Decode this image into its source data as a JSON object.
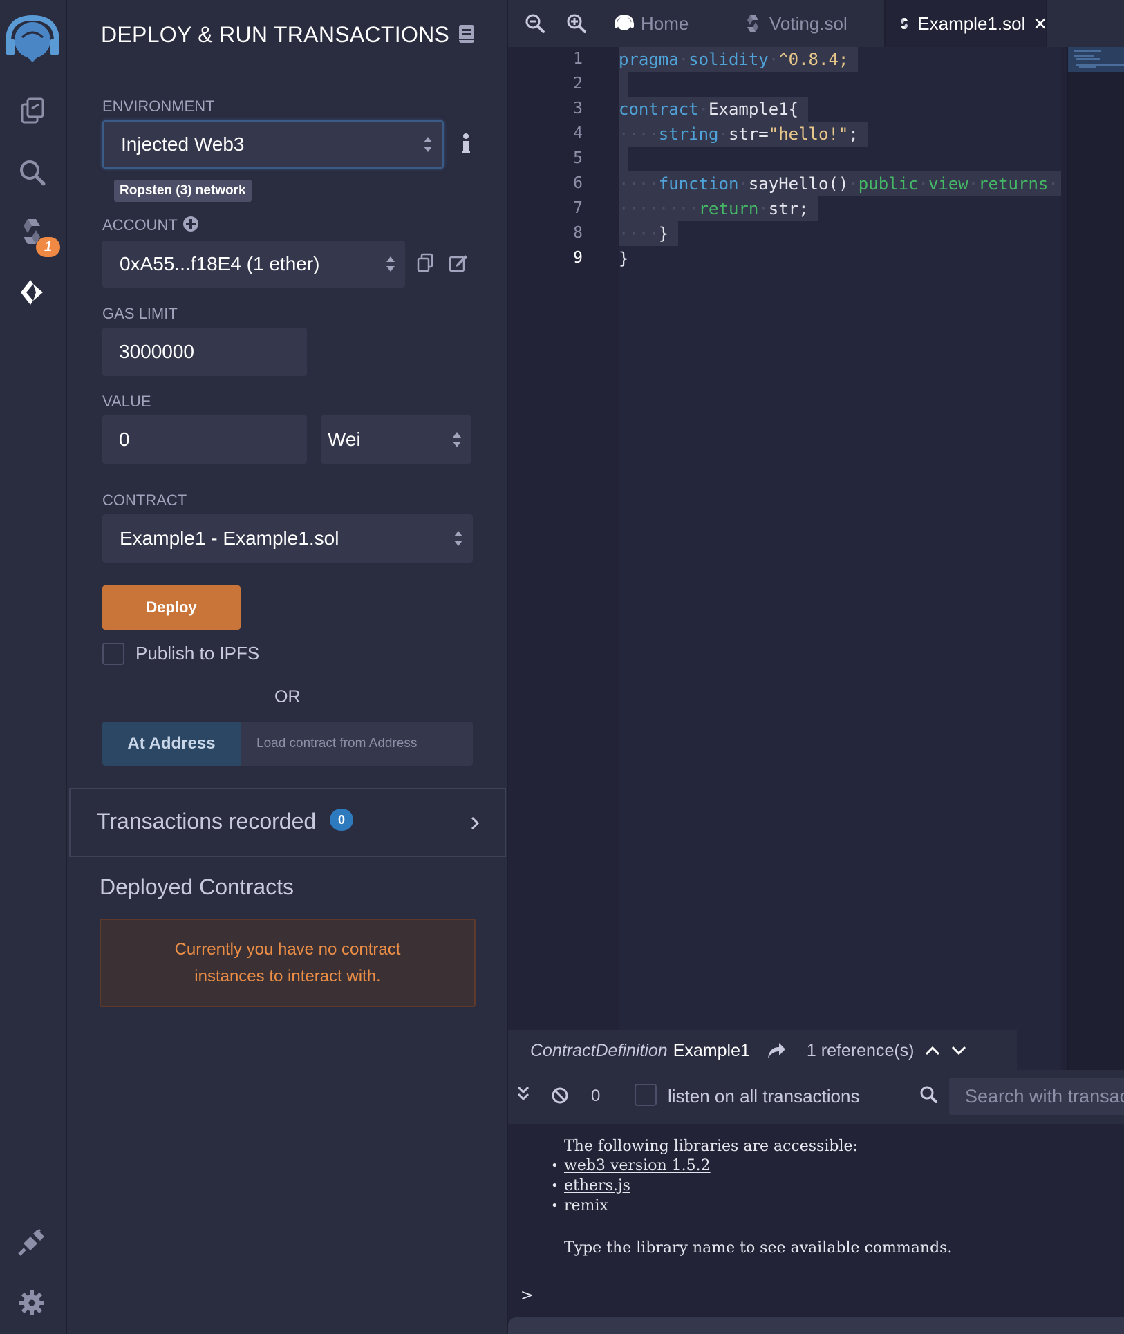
{
  "sidebar_rail": {
    "icons": [
      "remix-logo-icon",
      "file-explorer-icon",
      "search-icon",
      "solidity-compiler-icon",
      "deploy-run-icon",
      "plugin-manager-icon",
      "settings-icon"
    ],
    "compiler_badge": "1"
  },
  "panel": {
    "title": "DEPLOY & RUN TRANSACTIONS",
    "environment": {
      "label": "ENVIRONMENT",
      "value": "Injected Web3",
      "network_badge": "Ropsten (3) network"
    },
    "account": {
      "label": "ACCOUNT",
      "value": "0xA55...f18E4 (1 ether)"
    },
    "gas_limit": {
      "label": "GAS LIMIT",
      "value": "3000000"
    },
    "value": {
      "label": "VALUE",
      "amount": "0",
      "unit": "Wei"
    },
    "contract": {
      "label": "CONTRACT",
      "value": "Example1 - Example1.sol"
    },
    "deploy_label": "Deploy",
    "publish_label": "Publish to IPFS",
    "or_label": "OR",
    "at_address_label": "At Address",
    "at_address_placeholder": "Load contract from Address",
    "transactions": {
      "label": "Transactions recorded",
      "count": "0"
    },
    "deployed": {
      "title": "Deployed Contracts",
      "empty_line1": "Currently you have no contract",
      "empty_line2": "instances to interact with."
    }
  },
  "tabs": [
    {
      "label": "Home",
      "icon": "remix-icon"
    },
    {
      "label": "Voting.sol",
      "icon": "solidity-file-icon"
    },
    {
      "label": "Example1.sol",
      "icon": "solidity-file-icon",
      "active": true
    }
  ],
  "editor": {
    "line_numbers": [
      "1",
      "2",
      "3",
      "4",
      "5",
      "6",
      "7",
      "8",
      "9"
    ],
    "code": {
      "l1_kw": "pragma",
      "l1_kw2": "solidity",
      "l1_rest": "^0.8.4;",
      "l3_kw": "contract",
      "l3_rest": "Example1{",
      "l4_kw": "string",
      "l4_a": "str=",
      "l4_str": "\"hello!\"",
      "l4_end": ";",
      "l6_kw": "function",
      "l6_name": "sayHello()",
      "l6_mod1": "public",
      "l6_mod2": "view",
      "l6_mod3": "returns",
      "l7_kw": "return",
      "l7_rest": "str;",
      "l8": "}",
      "l9": "}"
    }
  },
  "reference_bar": {
    "kind": "ContractDefinition",
    "name": "Example1",
    "refs": "1 reference(s)"
  },
  "terminal": {
    "pending_count": "0",
    "listen_label": "listen on all transactions",
    "search_placeholder": "Search with transaction hash or address",
    "intro": "The following libraries are accessible:",
    "libs": [
      "web3 version 1.5.2",
      "ethers.js",
      "remix"
    ],
    "hint": "Type the library name to see available commands.",
    "prompt": ">"
  },
  "colors": {
    "background": "#222336",
    "panel": "#2a2c3f",
    "input": "#35384c",
    "deploy_button": "#c97539",
    "alert_text": "#ec8e46",
    "badge": "#2e7abf"
  }
}
